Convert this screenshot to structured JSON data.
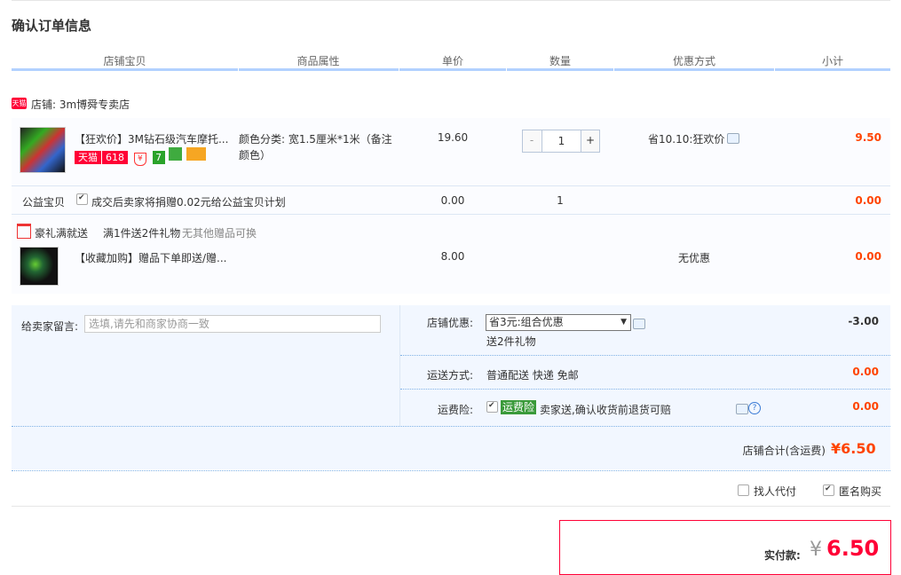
{
  "page": {
    "title": "确认订单信息"
  },
  "columns": [
    "店铺宝贝",
    "商品属性",
    "单价",
    "数量",
    "优惠方式",
    "小计"
  ],
  "shop": {
    "badge": "天猫",
    "name": "店铺: 3m博舜专卖店"
  },
  "item": {
    "name": "【狂欢价】3M钻石级汽车摩托...",
    "badge_tmall": "天猫",
    "badge_618": "618",
    "attr": "颜色分类: 宽1.5厘米*1米（备注颜色）",
    "price": "19.60",
    "qty": "1",
    "discount": "省10.10:狂欢价",
    "subtotal": "9.50"
  },
  "charity": {
    "label": "公益宝贝",
    "text": "成交后卖家将捐赠0.02元给公益宝贝计划",
    "price": "0.00",
    "qty": "1",
    "subtotal": "0.00"
  },
  "gift": {
    "label": "豪礼满就送",
    "rule": "满1件送2件礼物",
    "note": "无其他赠品可换"
  },
  "gift_item": {
    "name": "【收藏加购】赠品下单即送/赠...",
    "price": "8.00",
    "discount": "无优惠",
    "subtotal": "0.00"
  },
  "message": {
    "label": "给卖家留言:",
    "placeholder": "选填,请先和商家协商一致"
  },
  "shop_discount": {
    "label": "店铺优惠:",
    "selected": "省3元:组合优惠",
    "sub": "送2件礼物",
    "value": "-3.00"
  },
  "shipping": {
    "label": "运送方式:",
    "text": "普通配送 快递 免邮",
    "value": "0.00"
  },
  "insurance": {
    "label": "运费险:",
    "tag": "运费险",
    "text": "卖家送,确认收货前退货可赔",
    "value": "0.00"
  },
  "shop_total": {
    "label": "店铺合计(含运费)",
    "value": "¥6.50"
  },
  "options": {
    "proxy": "找人代付",
    "anonymous": "匿名购买"
  },
  "pay": {
    "label": "实付款:",
    "symbol": "¥",
    "amount": "6.50"
  },
  "colors": {
    "accent": "#ff0036",
    "header_bar": "#b2d1ff",
    "price": "#ff4400"
  }
}
